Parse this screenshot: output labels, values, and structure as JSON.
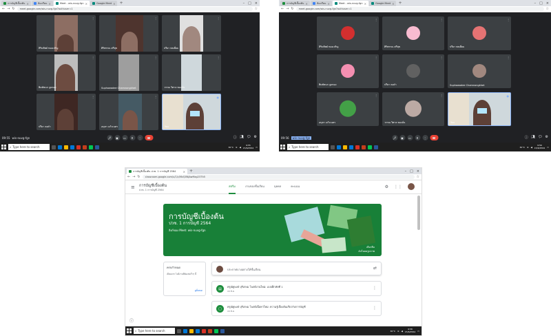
{
  "colors": {
    "meet_bg": "#202124",
    "tile_bg": "#3c4043",
    "end_call": "#ea4335",
    "classroom_green": "#188038",
    "accent_blue": "#1a73e8"
  },
  "shot1": {
    "tabs": [
      {
        "label": "การบัญชีเบื้องต้น",
        "color": "#1e8e3e"
      },
      {
        "label": "ห้องเรียน",
        "color": "#4285f4"
      },
      {
        "label": "Meet - wis-nuvg-fgn",
        "color": "#00897b"
      },
      {
        "label": "Google Meet",
        "color": "#00897b"
      }
    ],
    "url": "meet.google.com/wis-nuvg-fgn?authuser=1",
    "tiles": [
      {
        "name": "สิรินทิพย์ ทองเจริญ"
      },
      {
        "name": "ศิริพรรณ ศรีสุข"
      },
      {
        "name": "ปรียา พลเยี่ยม"
      },
      {
        "name": "พิมพ์ชนก จูมทอง"
      },
      {
        "name": "Suphawadee Chamnongkhet"
      },
      {
        "name": "วรรณ วิศาล ทองมั่น"
      },
      {
        "name": "ปรียา คงคำ"
      },
      {
        "name": "อนุชา แก้วเนตร"
      },
      {
        "name": "You"
      }
    ],
    "time": "09:55",
    "code": "wis-nuvg-fgn",
    "clock_time": "9:55",
    "clock_date": "15/6/2564"
  },
  "shot2": {
    "tabs": [
      {
        "label": "การบัญชีเบื้องต้น",
        "color": "#1e8e3e"
      },
      {
        "label": "ห้องเรียน",
        "color": "#4285f4"
      },
      {
        "label": "Meet - wis-nuvg-fgn",
        "color": "#00897b"
      },
      {
        "label": "Google Meet",
        "color": "#00897b"
      }
    ],
    "url": "meet.google.com/wis-nuvg-fgn?authuser=1",
    "tiles": [
      {
        "name": "สิรินทิพย์ ทองเจริญ",
        "avatar": "#d32f2f"
      },
      {
        "name": "ศิริพรรณ ศรีสุข",
        "avatar": "#f8bbd0"
      },
      {
        "name": "ปรียา พลเยี่ยม",
        "avatar": "#e57373"
      },
      {
        "name": "พิมพ์ชนก จูมทอง",
        "avatar": "#f48fb1"
      },
      {
        "name": "ปรียา คงคำ",
        "avatar": "#616161"
      },
      {
        "name": "Suphawadee Chamnongkhet",
        "avatar": "#a1887f"
      },
      {
        "name": "อนุชา แก้วเนตร",
        "avatar": "#43a047"
      },
      {
        "name": "วรรณ วิศาล ทองมั่น",
        "avatar": "#bcaaa4"
      },
      {
        "name": "You",
        "avatar": ""
      }
    ],
    "time": "09:56",
    "code": "wis-nuvg-fgn",
    "clock_time": "9:56",
    "clock_date": "15/6/2564"
  },
  "shot3": {
    "tab_label": "การบัญชีเบื้องต้น ปวช. 1 การบัญชี 2564",
    "url": "classroom.google.com/u/1/c/MzQ0NjAwMzg2OTk5",
    "class_title": "การบัญชีเบื้องต้น",
    "class_subtitle": "ปวช. 1 การบัญชี 2564",
    "tabs": [
      "สตรีม",
      "งานของชั้นเรียน",
      "บุคคล",
      "คะแนน"
    ],
    "banner_title": "การบัญชีเบื้องต้น",
    "banner_subtitle": "ปวช. 1 การบัญชี 2564",
    "banner_meet": "ลิงก์ของ Meet: wis-nuvg-fgn",
    "banner_select": "เลือกธีม",
    "banner_upload": "อัปโหลดรูปภาพ",
    "upcoming_title": "ครบกำหนด",
    "upcoming_msg": "เยี่ยมมาก ไม่มีงานที่ต้องส่งเร็วๆ นี้",
    "upcoming_link": "ดูทั้งหมด",
    "announce_placeholder": "ประกาศบางอย่างให้ชั้นเรียน",
    "posts": [
      {
        "title": "ครูณัฐพงษ์ บุรีเกษม โพสต์งานใหม่: แบบฝึกหัดที่ 1",
        "date": "15 มิ.ย."
      },
      {
        "title": "ครูณัฐพงษ์ บุรีเกษม โพสต์เนื้อหาใหม่: ความรู้เบื้องต้นเกี่ยวกับการบัญชี",
        "date": "15 มิ.ย."
      }
    ],
    "clock_time": "9:58",
    "clock_date": "15/6/2564"
  },
  "taskbar": {
    "search_placeholder": "Type here to search",
    "weather": "30°C"
  }
}
